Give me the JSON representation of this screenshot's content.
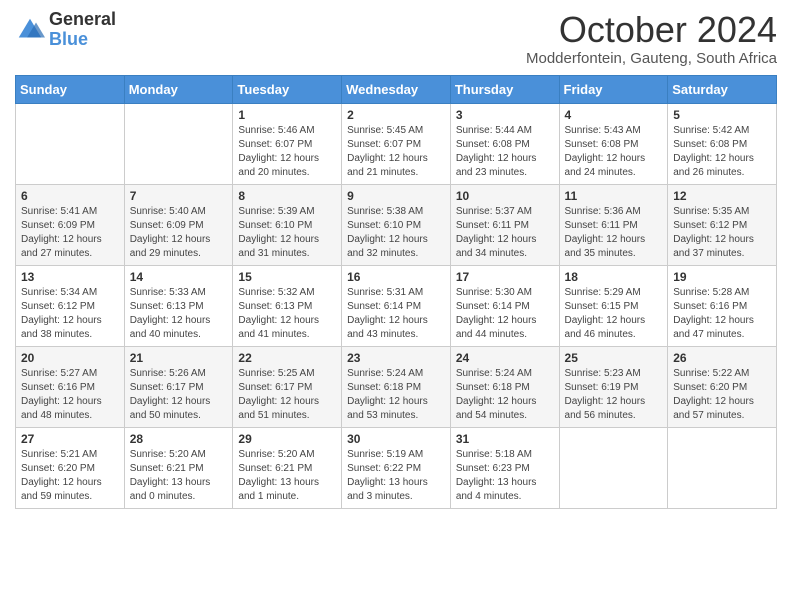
{
  "logo": {
    "general": "General",
    "blue": "Blue"
  },
  "header": {
    "month_title": "October 2024",
    "location": "Modderfontein, Gauteng, South Africa"
  },
  "days_of_week": [
    "Sunday",
    "Monday",
    "Tuesday",
    "Wednesday",
    "Thursday",
    "Friday",
    "Saturday"
  ],
  "weeks": [
    [
      {
        "day": "",
        "info": ""
      },
      {
        "day": "",
        "info": ""
      },
      {
        "day": "1",
        "info": "Sunrise: 5:46 AM\nSunset: 6:07 PM\nDaylight: 12 hours and 20 minutes."
      },
      {
        "day": "2",
        "info": "Sunrise: 5:45 AM\nSunset: 6:07 PM\nDaylight: 12 hours and 21 minutes."
      },
      {
        "day": "3",
        "info": "Sunrise: 5:44 AM\nSunset: 6:08 PM\nDaylight: 12 hours and 23 minutes."
      },
      {
        "day": "4",
        "info": "Sunrise: 5:43 AM\nSunset: 6:08 PM\nDaylight: 12 hours and 24 minutes."
      },
      {
        "day": "5",
        "info": "Sunrise: 5:42 AM\nSunset: 6:08 PM\nDaylight: 12 hours and 26 minutes."
      }
    ],
    [
      {
        "day": "6",
        "info": "Sunrise: 5:41 AM\nSunset: 6:09 PM\nDaylight: 12 hours and 27 minutes."
      },
      {
        "day": "7",
        "info": "Sunrise: 5:40 AM\nSunset: 6:09 PM\nDaylight: 12 hours and 29 minutes."
      },
      {
        "day": "8",
        "info": "Sunrise: 5:39 AM\nSunset: 6:10 PM\nDaylight: 12 hours and 31 minutes."
      },
      {
        "day": "9",
        "info": "Sunrise: 5:38 AM\nSunset: 6:10 PM\nDaylight: 12 hours and 32 minutes."
      },
      {
        "day": "10",
        "info": "Sunrise: 5:37 AM\nSunset: 6:11 PM\nDaylight: 12 hours and 34 minutes."
      },
      {
        "day": "11",
        "info": "Sunrise: 5:36 AM\nSunset: 6:11 PM\nDaylight: 12 hours and 35 minutes."
      },
      {
        "day": "12",
        "info": "Sunrise: 5:35 AM\nSunset: 6:12 PM\nDaylight: 12 hours and 37 minutes."
      }
    ],
    [
      {
        "day": "13",
        "info": "Sunrise: 5:34 AM\nSunset: 6:12 PM\nDaylight: 12 hours and 38 minutes."
      },
      {
        "day": "14",
        "info": "Sunrise: 5:33 AM\nSunset: 6:13 PM\nDaylight: 12 hours and 40 minutes."
      },
      {
        "day": "15",
        "info": "Sunrise: 5:32 AM\nSunset: 6:13 PM\nDaylight: 12 hours and 41 minutes."
      },
      {
        "day": "16",
        "info": "Sunrise: 5:31 AM\nSunset: 6:14 PM\nDaylight: 12 hours and 43 minutes."
      },
      {
        "day": "17",
        "info": "Sunrise: 5:30 AM\nSunset: 6:14 PM\nDaylight: 12 hours and 44 minutes."
      },
      {
        "day": "18",
        "info": "Sunrise: 5:29 AM\nSunset: 6:15 PM\nDaylight: 12 hours and 46 minutes."
      },
      {
        "day": "19",
        "info": "Sunrise: 5:28 AM\nSunset: 6:16 PM\nDaylight: 12 hours and 47 minutes."
      }
    ],
    [
      {
        "day": "20",
        "info": "Sunrise: 5:27 AM\nSunset: 6:16 PM\nDaylight: 12 hours and 48 minutes."
      },
      {
        "day": "21",
        "info": "Sunrise: 5:26 AM\nSunset: 6:17 PM\nDaylight: 12 hours and 50 minutes."
      },
      {
        "day": "22",
        "info": "Sunrise: 5:25 AM\nSunset: 6:17 PM\nDaylight: 12 hours and 51 minutes."
      },
      {
        "day": "23",
        "info": "Sunrise: 5:24 AM\nSunset: 6:18 PM\nDaylight: 12 hours and 53 minutes."
      },
      {
        "day": "24",
        "info": "Sunrise: 5:24 AM\nSunset: 6:18 PM\nDaylight: 12 hours and 54 minutes."
      },
      {
        "day": "25",
        "info": "Sunrise: 5:23 AM\nSunset: 6:19 PM\nDaylight: 12 hours and 56 minutes."
      },
      {
        "day": "26",
        "info": "Sunrise: 5:22 AM\nSunset: 6:20 PM\nDaylight: 12 hours and 57 minutes."
      }
    ],
    [
      {
        "day": "27",
        "info": "Sunrise: 5:21 AM\nSunset: 6:20 PM\nDaylight: 12 hours and 59 minutes."
      },
      {
        "day": "28",
        "info": "Sunrise: 5:20 AM\nSunset: 6:21 PM\nDaylight: 13 hours and 0 minutes."
      },
      {
        "day": "29",
        "info": "Sunrise: 5:20 AM\nSunset: 6:21 PM\nDaylight: 13 hours and 1 minute."
      },
      {
        "day": "30",
        "info": "Sunrise: 5:19 AM\nSunset: 6:22 PM\nDaylight: 13 hours and 3 minutes."
      },
      {
        "day": "31",
        "info": "Sunrise: 5:18 AM\nSunset: 6:23 PM\nDaylight: 13 hours and 4 minutes."
      },
      {
        "day": "",
        "info": ""
      },
      {
        "day": "",
        "info": ""
      }
    ]
  ]
}
